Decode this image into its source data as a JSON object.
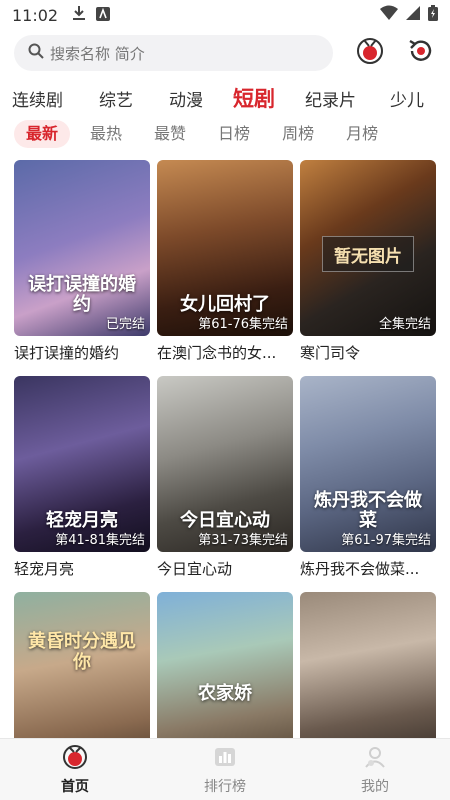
{
  "status_bar": {
    "time": "11:02"
  },
  "search": {
    "placeholder": "搜索名称 简介"
  },
  "categories": [
    {
      "label": "连续剧",
      "active": false
    },
    {
      "label": "综艺",
      "active": false
    },
    {
      "label": "动漫",
      "active": false
    },
    {
      "label": "短剧",
      "active": true
    },
    {
      "label": "纪录片",
      "active": false
    },
    {
      "label": "少儿",
      "active": false
    }
  ],
  "sub_tabs": [
    {
      "label": "最新",
      "active": true
    },
    {
      "label": "最热",
      "active": false
    },
    {
      "label": "最赞",
      "active": false
    },
    {
      "label": "日榜",
      "active": false
    },
    {
      "label": "周榜",
      "active": false
    },
    {
      "label": "月榜",
      "active": false
    }
  ],
  "cards": [
    {
      "title": "误打误撞的婚约",
      "badge": "已完结",
      "poster_text": "误打误撞的婚约"
    },
    {
      "title": "在澳门念书的女...",
      "badge": "第61-76集完结",
      "poster_text": "女儿回村了"
    },
    {
      "title": "寒门司令",
      "badge": "全集完结",
      "poster_text": "暂无图片"
    },
    {
      "title": "轻宠月亮",
      "badge": "第41-81集完结",
      "poster_text": "轻宠月亮"
    },
    {
      "title": "今日宜心动",
      "badge": "第31-73集完结",
      "poster_text": "今日宜心动"
    },
    {
      "title": "炼丹我不会做菜...",
      "badge": "第61-97集完结",
      "poster_text": "炼丹我不会做菜"
    },
    {
      "title": "",
      "badge": "",
      "poster_text": "黄昏时分遇见你"
    },
    {
      "title": "",
      "badge": "",
      "poster_text": "农家娇"
    },
    {
      "title": "",
      "badge": "",
      "poster_text": ""
    }
  ],
  "bottom_nav": [
    {
      "label": "首页",
      "icon": "home-icon",
      "active": true
    },
    {
      "label": "排行榜",
      "icon": "ranking-icon",
      "active": false
    },
    {
      "label": "我的",
      "icon": "profile-icon",
      "active": false
    }
  ],
  "colors": {
    "accent": "#d8262d",
    "accent_soft": "#fde9e9"
  }
}
